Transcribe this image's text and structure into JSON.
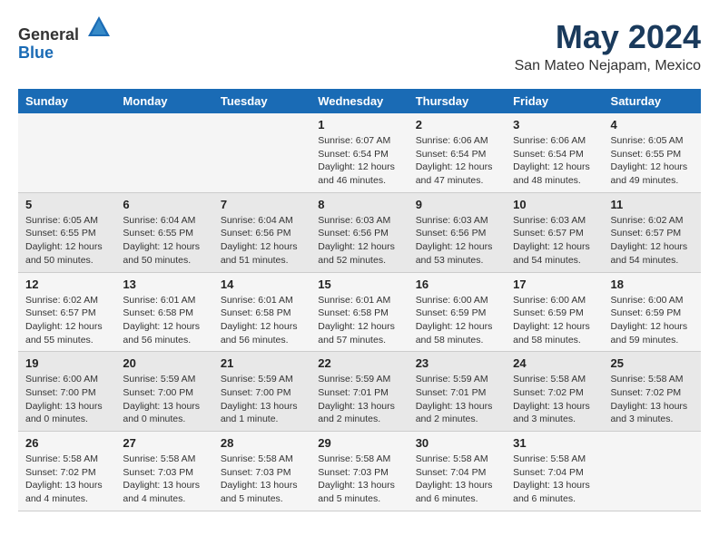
{
  "logo": {
    "general": "General",
    "blue": "Blue"
  },
  "title": "May 2024",
  "subtitle": "San Mateo Nejapam, Mexico",
  "days_of_week": [
    "Sunday",
    "Monday",
    "Tuesday",
    "Wednesday",
    "Thursday",
    "Friday",
    "Saturday"
  ],
  "weeks": [
    [
      {
        "day": "",
        "info": ""
      },
      {
        "day": "",
        "info": ""
      },
      {
        "day": "",
        "info": ""
      },
      {
        "day": "1",
        "info": "Sunrise: 6:07 AM\nSunset: 6:54 PM\nDaylight: 12 hours and 46 minutes."
      },
      {
        "day": "2",
        "info": "Sunrise: 6:06 AM\nSunset: 6:54 PM\nDaylight: 12 hours and 47 minutes."
      },
      {
        "day": "3",
        "info": "Sunrise: 6:06 AM\nSunset: 6:54 PM\nDaylight: 12 hours and 48 minutes."
      },
      {
        "day": "4",
        "info": "Sunrise: 6:05 AM\nSunset: 6:55 PM\nDaylight: 12 hours and 49 minutes."
      }
    ],
    [
      {
        "day": "5",
        "info": "Sunrise: 6:05 AM\nSunset: 6:55 PM\nDaylight: 12 hours and 50 minutes."
      },
      {
        "day": "6",
        "info": "Sunrise: 6:04 AM\nSunset: 6:55 PM\nDaylight: 12 hours and 50 minutes."
      },
      {
        "day": "7",
        "info": "Sunrise: 6:04 AM\nSunset: 6:56 PM\nDaylight: 12 hours and 51 minutes."
      },
      {
        "day": "8",
        "info": "Sunrise: 6:03 AM\nSunset: 6:56 PM\nDaylight: 12 hours and 52 minutes."
      },
      {
        "day": "9",
        "info": "Sunrise: 6:03 AM\nSunset: 6:56 PM\nDaylight: 12 hours and 53 minutes."
      },
      {
        "day": "10",
        "info": "Sunrise: 6:03 AM\nSunset: 6:57 PM\nDaylight: 12 hours and 54 minutes."
      },
      {
        "day": "11",
        "info": "Sunrise: 6:02 AM\nSunset: 6:57 PM\nDaylight: 12 hours and 54 minutes."
      }
    ],
    [
      {
        "day": "12",
        "info": "Sunrise: 6:02 AM\nSunset: 6:57 PM\nDaylight: 12 hours and 55 minutes."
      },
      {
        "day": "13",
        "info": "Sunrise: 6:01 AM\nSunset: 6:58 PM\nDaylight: 12 hours and 56 minutes."
      },
      {
        "day": "14",
        "info": "Sunrise: 6:01 AM\nSunset: 6:58 PM\nDaylight: 12 hours and 56 minutes."
      },
      {
        "day": "15",
        "info": "Sunrise: 6:01 AM\nSunset: 6:58 PM\nDaylight: 12 hours and 57 minutes."
      },
      {
        "day": "16",
        "info": "Sunrise: 6:00 AM\nSunset: 6:59 PM\nDaylight: 12 hours and 58 minutes."
      },
      {
        "day": "17",
        "info": "Sunrise: 6:00 AM\nSunset: 6:59 PM\nDaylight: 12 hours and 58 minutes."
      },
      {
        "day": "18",
        "info": "Sunrise: 6:00 AM\nSunset: 6:59 PM\nDaylight: 12 hours and 59 minutes."
      }
    ],
    [
      {
        "day": "19",
        "info": "Sunrise: 6:00 AM\nSunset: 7:00 PM\nDaylight: 13 hours and 0 minutes."
      },
      {
        "day": "20",
        "info": "Sunrise: 5:59 AM\nSunset: 7:00 PM\nDaylight: 13 hours and 0 minutes."
      },
      {
        "day": "21",
        "info": "Sunrise: 5:59 AM\nSunset: 7:00 PM\nDaylight: 13 hours and 1 minute."
      },
      {
        "day": "22",
        "info": "Sunrise: 5:59 AM\nSunset: 7:01 PM\nDaylight: 13 hours and 2 minutes."
      },
      {
        "day": "23",
        "info": "Sunrise: 5:59 AM\nSunset: 7:01 PM\nDaylight: 13 hours and 2 minutes."
      },
      {
        "day": "24",
        "info": "Sunrise: 5:58 AM\nSunset: 7:02 PM\nDaylight: 13 hours and 3 minutes."
      },
      {
        "day": "25",
        "info": "Sunrise: 5:58 AM\nSunset: 7:02 PM\nDaylight: 13 hours and 3 minutes."
      }
    ],
    [
      {
        "day": "26",
        "info": "Sunrise: 5:58 AM\nSunset: 7:02 PM\nDaylight: 13 hours and 4 minutes."
      },
      {
        "day": "27",
        "info": "Sunrise: 5:58 AM\nSunset: 7:03 PM\nDaylight: 13 hours and 4 minutes."
      },
      {
        "day": "28",
        "info": "Sunrise: 5:58 AM\nSunset: 7:03 PM\nDaylight: 13 hours and 5 minutes."
      },
      {
        "day": "29",
        "info": "Sunrise: 5:58 AM\nSunset: 7:03 PM\nDaylight: 13 hours and 5 minutes."
      },
      {
        "day": "30",
        "info": "Sunrise: 5:58 AM\nSunset: 7:04 PM\nDaylight: 13 hours and 6 minutes."
      },
      {
        "day": "31",
        "info": "Sunrise: 5:58 AM\nSunset: 7:04 PM\nDaylight: 13 hours and 6 minutes."
      },
      {
        "day": "",
        "info": ""
      }
    ]
  ]
}
